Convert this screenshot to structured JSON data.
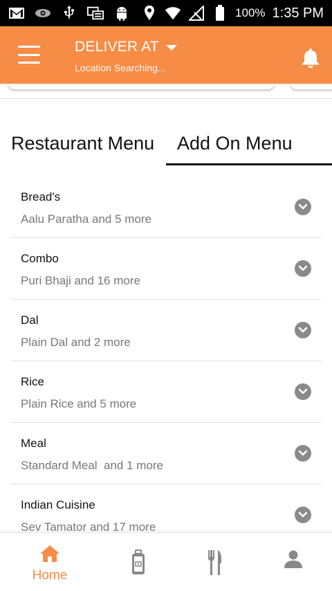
{
  "status_bar": {
    "battery_percent": "100%",
    "time": "1:35 PM",
    "left_icons": [
      "gmail-icon",
      "eye-icon",
      "usb-icon",
      "screens-icon",
      "android-icon"
    ],
    "right_icons": [
      "location-icon",
      "wifi-icon",
      "no-signal-icon",
      "battery-icon"
    ]
  },
  "header": {
    "deliver_label": "DELIVER AT",
    "location_text": "Location Searching...",
    "accent_color": "#f78c46"
  },
  "tabs": [
    {
      "label": "Restaurant Menu",
      "active": false
    },
    {
      "label": "Add On Menu",
      "active": true
    }
  ],
  "categories": [
    {
      "title": "Bread's",
      "subtitle": "Aalu Paratha and 5 more"
    },
    {
      "title": "Combo",
      "subtitle": "Puri Bhaji and 16 more"
    },
    {
      "title": "Dal",
      "subtitle": "Plain Dal and 2 more"
    },
    {
      "title": "Rice",
      "subtitle": "Plain Rice and 5 more"
    },
    {
      "title": "Meal",
      "subtitle": "Standard Meal  and 1 more"
    },
    {
      "title": "Indian Cuisine",
      "subtitle": "Sev Tamator and 17 more"
    }
  ],
  "bottom_nav": {
    "home_label": "Home",
    "items": [
      "home-icon",
      "orders-icon",
      "restaurant-menu-icon",
      "profile-icon"
    ]
  }
}
